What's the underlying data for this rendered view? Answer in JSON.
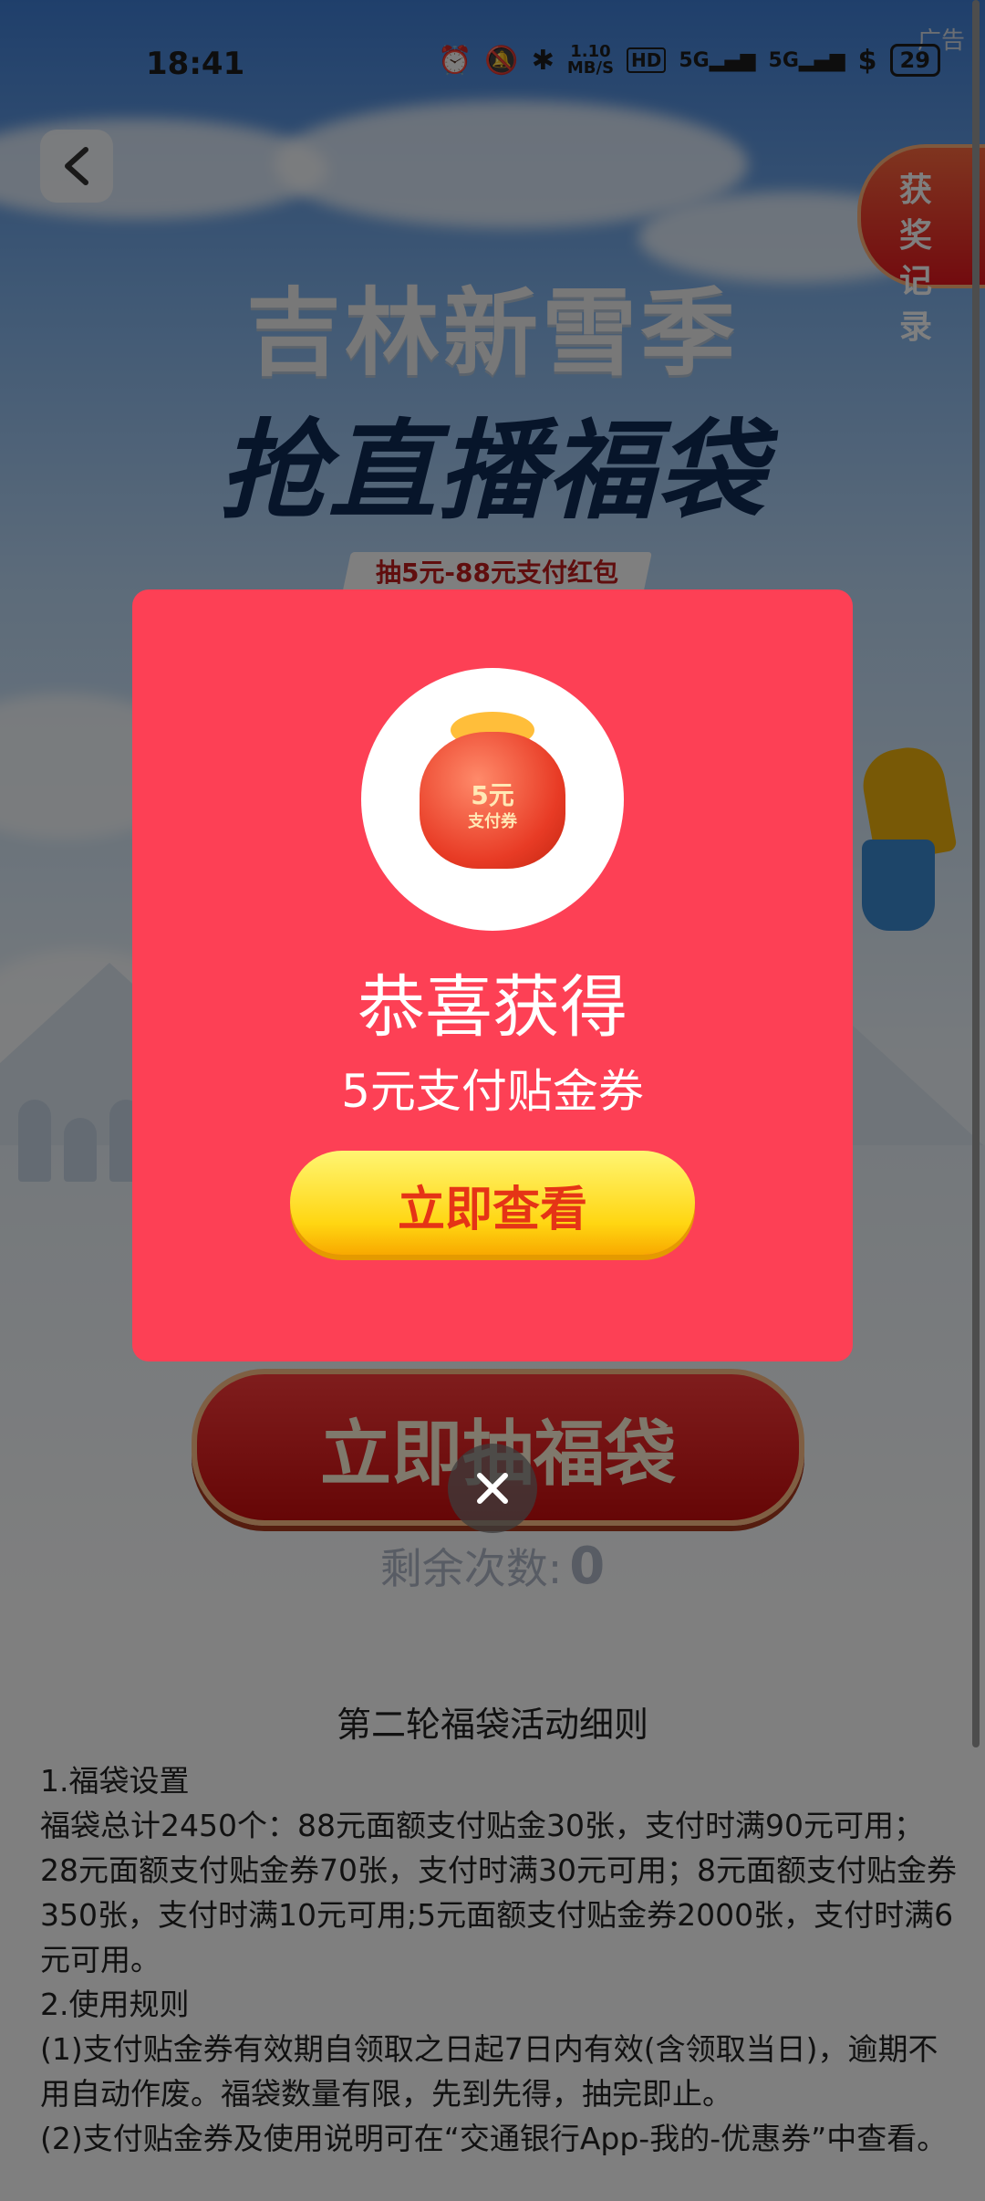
{
  "status_bar": {
    "time": "18:41",
    "net_speed_value": "1.10",
    "net_speed_unit": "MB/S",
    "hd": "HD",
    "signal_1": "5G",
    "signal_2": "5G",
    "battery": "29"
  },
  "ad_label": "广告",
  "hero": {
    "title_line1": "吉林新雪季",
    "title_line2": "抢直播福袋",
    "subtitle": "抽5元-88元支付红包",
    "record_button": "获奖记录",
    "draw_button": "立即抽福袋",
    "remaining_label": "剩余次数:",
    "remaining_count": "0"
  },
  "modal": {
    "bag_label_value": "5元",
    "bag_label_text": "支付券",
    "title": "恭喜获得",
    "prize": "5元支付贴金券",
    "view_button": "立即查看"
  },
  "rules": {
    "title": "第二轮福袋活动细则",
    "lines": [
      "1.福袋设置",
      "福袋总计2450个：88元面额支付贴金30张，支付时满90元可用；28元面额支付贴金券70张，支付时满30元可用；8元面额支付贴金券350张，支付时满10元可用;5元面额支付贴金券2000张，支付时满6元可用。",
      "2.使用规则",
      "(1)支付贴金券有效期自领取之日起7日内有效(含领取当日)，逾期不用自动作废。福袋数量有限，先到先得，抽完即止。",
      "(2)支付贴金券及使用说明可在“交通银行App-我的-优惠券”中查看。"
    ]
  },
  "colors": {
    "modal_bg": "#fd4055",
    "view_button": "#ffd612",
    "draw_button": "#e01a1a"
  }
}
